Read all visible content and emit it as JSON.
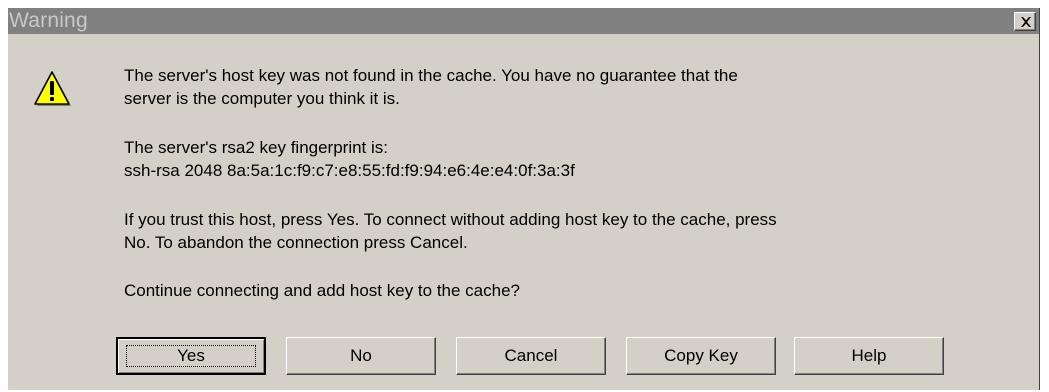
{
  "window": {
    "title": "Warning",
    "close_glyph": "✕"
  },
  "icons": {
    "warning": "warning-triangle-icon",
    "close": "close-icon"
  },
  "message": {
    "line1": "The server's host key was not found in the cache. You have no guarantee that the",
    "line2": "server is the computer you think it is.",
    "line3": "The server's rsa2 key fingerprint is:",
    "line4": "ssh-rsa 2048 8a:5a:1c:f9:c7:e8:55:fd:f9:94:e6:4e:e4:0f:3a:3f",
    "line5": "If you trust this host, press Yes. To connect without adding host key to the cache, press",
    "line6": "No. To abandon the connection press Cancel.",
    "line7": "Continue connecting and add host key to the cache?"
  },
  "buttons": {
    "yes": "Yes",
    "no": "No",
    "cancel": "Cancel",
    "copy_key": "Copy Key",
    "help": "Help"
  },
  "colors": {
    "dialog_face": "#d4d0c8",
    "titlebar": "#808080",
    "warning_yellow": "#ffff00"
  }
}
